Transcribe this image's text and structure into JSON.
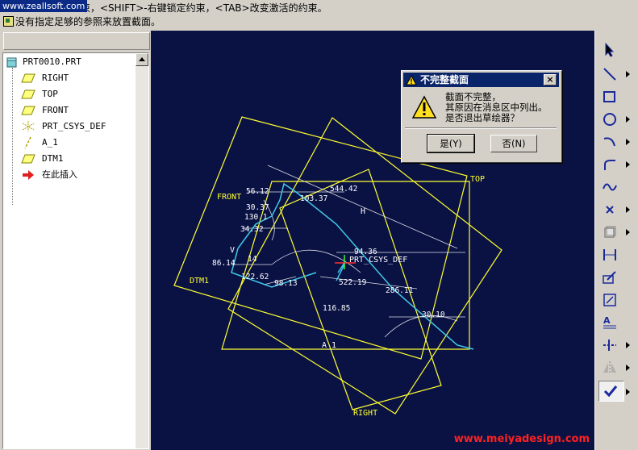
{
  "watermark_top": "www.zeallsoft.com",
  "message_area": {
    "line1": "约束，<SHIFT>-右键锁定约束，<TAB>改变激活的约束。",
    "line2": "没有指定足够的参照来放置截面。"
  },
  "model_tree": {
    "root": "PRT0010.PRT",
    "items": [
      {
        "label": "RIGHT",
        "icon": "datum-plane-icon"
      },
      {
        "label": "TOP",
        "icon": "datum-plane-icon"
      },
      {
        "label": "FRONT",
        "icon": "datum-plane-icon"
      },
      {
        "label": "PRT_CSYS_DEF",
        "icon": "csys-icon"
      },
      {
        "label": "A_1",
        "icon": "datum-axis-icon"
      },
      {
        "label": "DTM1",
        "icon": "datum-plane-icon"
      },
      {
        "label": "在此插入",
        "icon": "insert-here-arrow-icon"
      }
    ]
  },
  "canvas": {
    "labels": {
      "top": "TOP",
      "front": "FRONT",
      "dtm1": "DTM1",
      "right": "RIGHT",
      "a1": "A_1",
      "csys": "PRT_CSYS_DEF",
      "h": "H",
      "v": "V"
    },
    "dimensions": [
      "544.42",
      "103.37",
      "56.12",
      "30.37",
      "130.1",
      "34.32",
      "94.36",
      "86.14",
      "14",
      "122.62",
      "98.13",
      "522.19",
      "286.11",
      "116.85",
      "30.10"
    ]
  },
  "dialog": {
    "title": "不完整截面",
    "message_lines": [
      "截面不完整，",
      "其原因在消息区中列出。",
      "是否退出草绘器？"
    ],
    "yes_label": "是(Y)",
    "no_label": "否(N)",
    "close_label": "×"
  },
  "sketch_tools": [
    "select-arrow-icon",
    "line-icon",
    "rectangle-icon",
    "circle-icon",
    "arc-icon",
    "fillet-icon",
    "spline-icon",
    "point-icon",
    "use-edge-icon",
    "dimension-icon",
    "modify-icon",
    "constraint-icon",
    "text-icon",
    "trim-icon",
    "mirror-icon",
    "done-check-icon"
  ],
  "brand_watermark": "www.meiyadesign.com",
  "colors": {
    "canvas_bg": "#0a1244",
    "datum": "#ffff30",
    "sketch": "#40c8e8",
    "dimension_text": "#ffffff",
    "dialog_title": "#0a246a"
  }
}
